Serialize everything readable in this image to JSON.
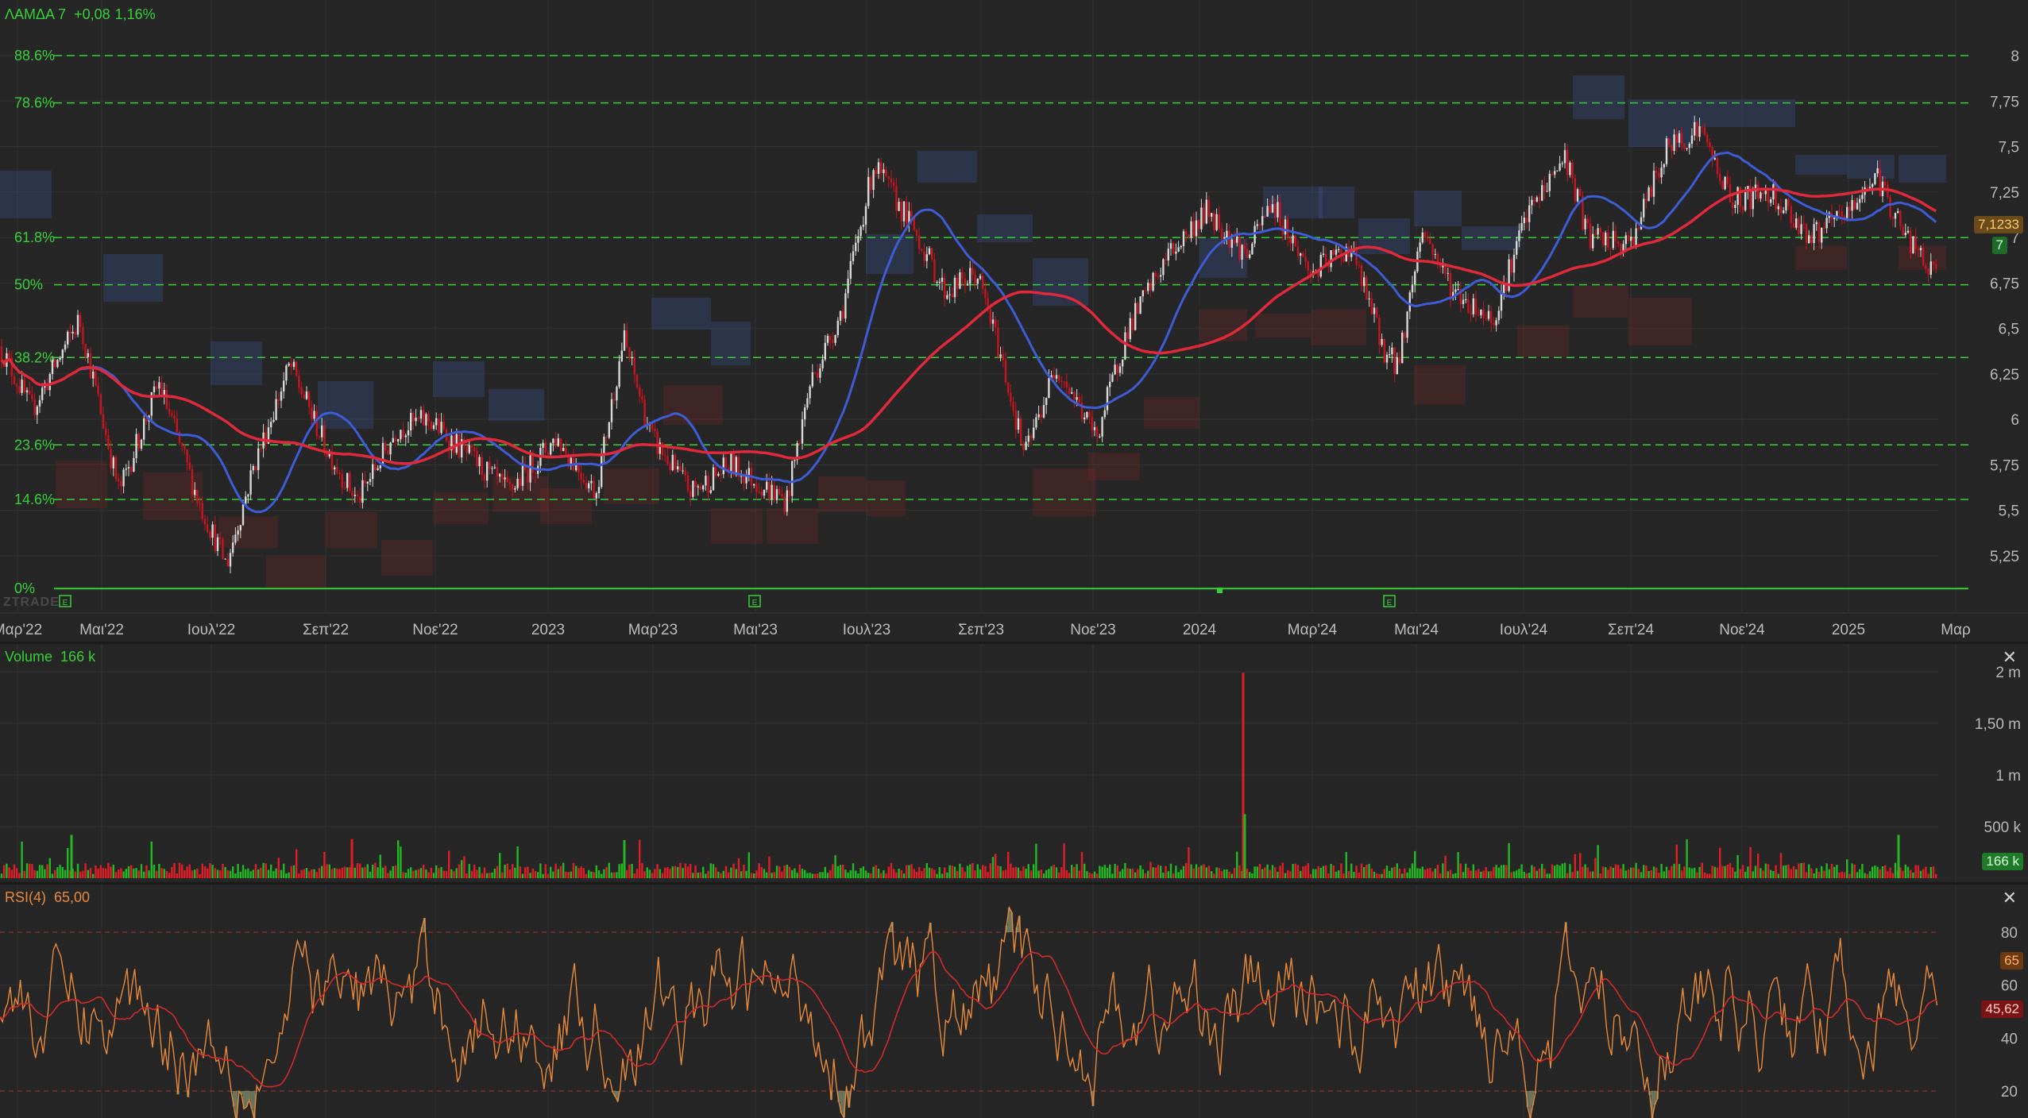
{
  "ticker": {
    "symbol": "ΛΑΜΔΑ 7",
    "change": "+0,08",
    "change_pct": "1,16%"
  },
  "price_axis": {
    "labels": [
      "8",
      "7,75",
      "7,5",
      "7,25",
      "7",
      "6,75",
      "6,5",
      "6,25",
      "6",
      "5,75",
      "5,5",
      "5,25"
    ],
    "last_price": "7,1233",
    "secondary_price": "7"
  },
  "fibonacci": {
    "levels": [
      "88.6%",
      "78.6%",
      "61.8%",
      "50%",
      "38.2%",
      "23.6%",
      "14.6%",
      "0%"
    ],
    "values": [
      8.0,
      7.74,
      7.0,
      6.74,
      6.34,
      5.86,
      5.56,
      5.07
    ]
  },
  "time_axis": {
    "labels": [
      "Μαρ'22",
      "Μαι'22",
      "Ιουλ'22",
      "Σεπ'22",
      "Νοε'22",
      "2023",
      "Μαρ'23",
      "Μαι'23",
      "Ιουλ'23",
      "Σεπ'23",
      "Νοε'23",
      "2024",
      "Μαρ'24",
      "Μαι'24",
      "Ιουλ'24",
      "Σεπ'24",
      "Νοε'24",
      "2025",
      "Μαρ"
    ]
  },
  "watermark": "ZTRADE",
  "volume_panel": {
    "title": "Volume",
    "value": "166 k",
    "axis_labels": [
      "2 m",
      "1,50 m",
      "1 m",
      "500 k"
    ],
    "badge": "166 k",
    "close_label": "✕"
  },
  "rsi_panel": {
    "title": "RSI(4)",
    "value": "65,00",
    "axis_labels": [
      "80",
      "60",
      "40",
      "20"
    ],
    "badge_rsi": "65",
    "badge_ma": "45,62",
    "close_label": "✕"
  },
  "colors": {
    "background": "#262626",
    "up": "#22b822",
    "down": "#e01e28",
    "candle_up": "#d8d8d8",
    "candle_down": "#c8141e",
    "ma_fast": "#3e5cd6",
    "ma_slow": "#e02a3c",
    "fib": "#37d037",
    "rsi": "#e8893a",
    "rsi_ma": "#d42a2a",
    "header_text": "#37d037",
    "rsi_header": "#e8893a"
  }
}
